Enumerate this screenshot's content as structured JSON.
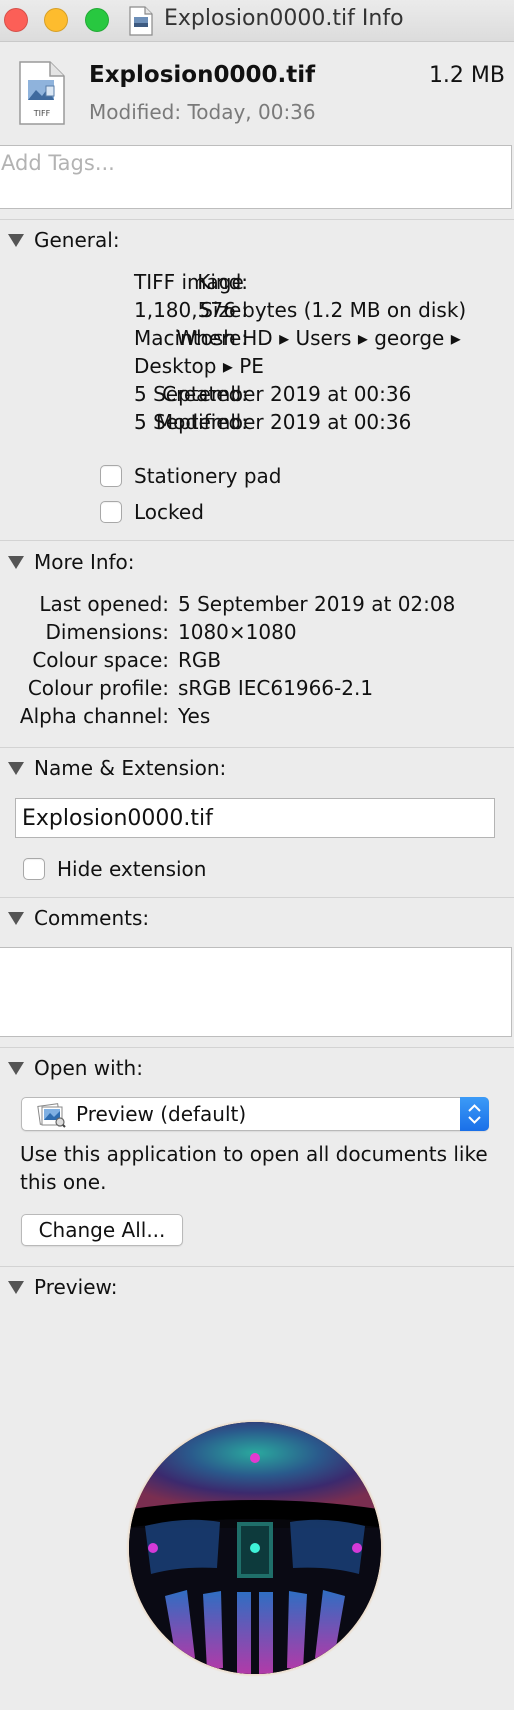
{
  "window": {
    "title": "Explosion0000.tif Info",
    "traffic_lights": [
      "close",
      "minimize",
      "zoom"
    ]
  },
  "header": {
    "file_name": "Explosion0000.tif",
    "file_size": "1.2 MB",
    "modified": "Modified: Today, 00:36",
    "file_icon_badge": "TIFF"
  },
  "tags": {
    "placeholder": "Add Tags..."
  },
  "general": {
    "title": "General:",
    "kind_label": "Kind:",
    "kind_value": "TIFF image",
    "size_label": "Size:",
    "size_value": "1,180,576 bytes (1.2 MB on disk)",
    "where_label": "Where:",
    "where_value_line1": "Macintosh HD ▸ Users ▸ george ▸",
    "where_value_line2": "Desktop ▸ PE",
    "created_label": "Created:",
    "created_value": "5 September 2019 at 00:36",
    "modified_label": "Modified:",
    "modified_value": "5 September 2019 at 00:36",
    "stationery_label": "Stationery pad",
    "stationery_checked": false,
    "locked_label": "Locked",
    "locked_checked": false
  },
  "more_info": {
    "title": "More Info:",
    "last_opened_label": "Last opened:",
    "last_opened_value": "5 September 2019 at 02:08",
    "dimensions_label": "Dimensions:",
    "dimensions_value": "1080×1080",
    "colour_space_label": "Colour space:",
    "colour_space_value": "RGB",
    "colour_profile_label": "Colour profile:",
    "colour_profile_value": "sRGB IEC61966-2.1",
    "alpha_label": "Alpha channel:",
    "alpha_value": "Yes"
  },
  "name_extension": {
    "title": "Name & Extension:",
    "name_value": "Explosion0000.tif",
    "hide_extension_label": "Hide extension",
    "hide_extension_checked": false
  },
  "comments": {
    "title": "Comments:",
    "value": ""
  },
  "open_with": {
    "title": "Open with:",
    "selected_app": "Preview (default)",
    "description": "Use this application to open all documents like this one.",
    "change_all_label": "Change All..."
  },
  "preview": {
    "title": "Preview:"
  },
  "icons": {
    "file": "tiff-document-icon",
    "app": "preview-app-icon",
    "disclosure": "disclosure-triangle-icon",
    "stepper": "popup-stepper-icon"
  },
  "colors": {
    "background": "#ececec",
    "accent": "#1a6fe8",
    "secondary_text": "#7a7a7a"
  }
}
